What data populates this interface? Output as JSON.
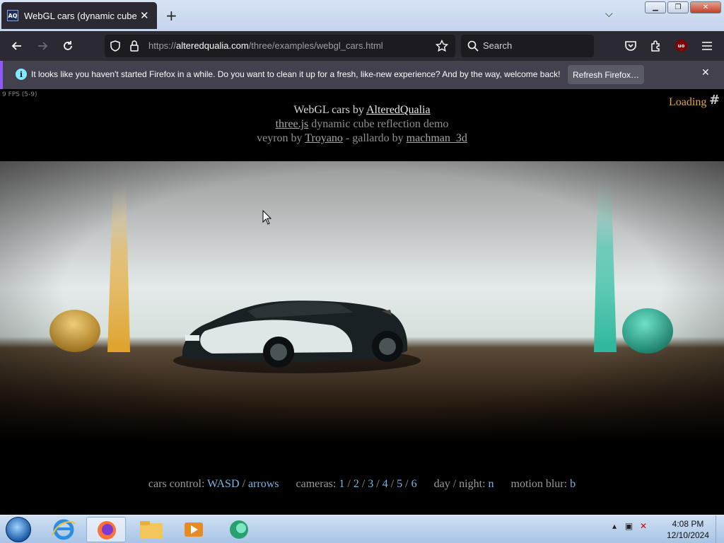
{
  "browser": {
    "tab": {
      "favicon_text": "AQ",
      "title": "WebGL cars (dynamic cubemap",
      "close_label": "✕"
    },
    "new_tab_label": "+",
    "tab_list_label": "⌵",
    "url": {
      "prefix": "https://",
      "domain": "alteredqualia.com",
      "path": "/three/examples/webgl_cars.html"
    },
    "search_placeholder": "Search",
    "extension_badge": "uo"
  },
  "notification": {
    "message": "It looks like you haven't started Firefox in a while. Do you want to clean it up for a fresh, like-new experience? And by the way, welcome back!",
    "button_label": "Refresh Firefox…",
    "close_label": "✕"
  },
  "page": {
    "fps": "9 FPS (5-9)",
    "loading": "Loading",
    "title_prefix": "WebGL cars by",
    "title_link": "AlteredQualia",
    "line2_link": "three.js",
    "line2_text": "dynamic cube reflection demo",
    "line3_prefix": "veyron by",
    "line3_link1": "Troyano",
    "line3_middle": "- gallardo by",
    "line3_link2": "machman_3d",
    "controls": {
      "cars_label": "cars control:",
      "wasd": "WASD",
      "slash": "/",
      "arrows": "arrows",
      "cameras_label": "cameras:",
      "cam1": "1",
      "cam2": "2",
      "cam3": "3",
      "cam4": "4",
      "cam5": "5",
      "cam6": "6",
      "daynight_label": "day / night:",
      "n": "n",
      "blur_label": "motion blur:",
      "b": "b"
    }
  },
  "taskbar": {
    "time": "4:08 PM",
    "date": "12/10/2024"
  },
  "colors": {
    "link_key": "#76b7e3",
    "loading": "#e3a34a",
    "firefox_dark": "#2b2a33"
  }
}
